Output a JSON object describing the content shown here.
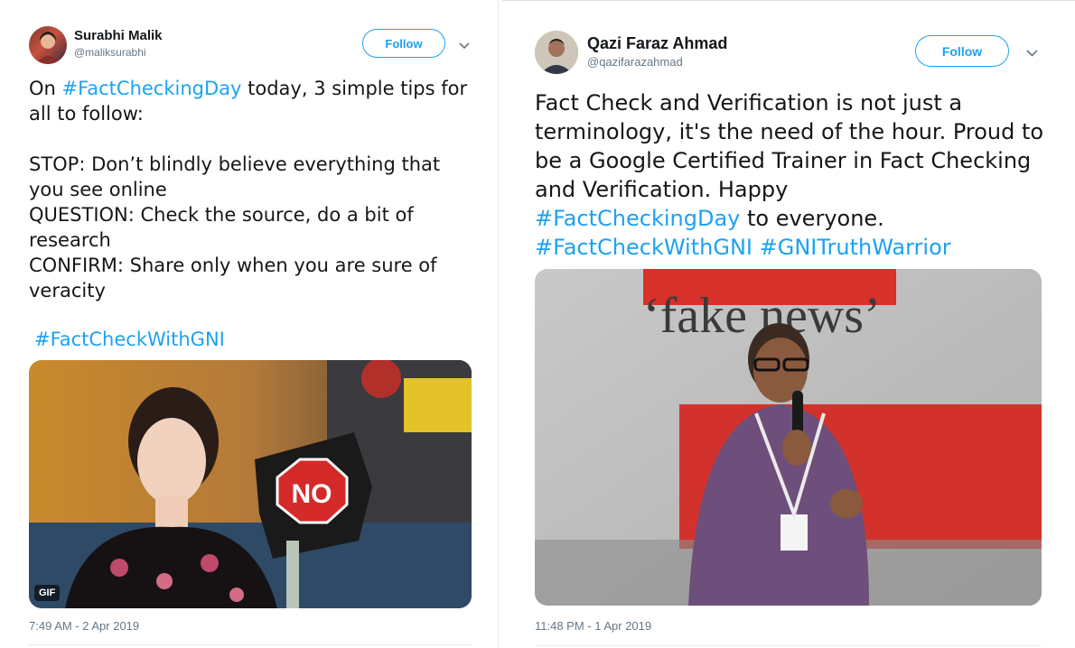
{
  "tweets": [
    {
      "name": "Surabhi Malik",
      "handle": "@maliksurabhi",
      "follow_label": "Follow",
      "text_prefix": "On ",
      "hashtag_inline": "#FactCheckingDay",
      "text_rest": " today, 3 simple tips for all to follow:\n\nSTOP: Don’t blindly believe everything that you see online\nQUESTION: Check the source, do a bit of research\nCONFIRM: Share only when you are sure of veracity",
      "hashtag_footer": "#FactCheckWithGNI",
      "media": {
        "badge": "GIF",
        "sign_text": "NO"
      },
      "timestamp": "7:49 AM - 2 Apr 2019"
    },
    {
      "name": "Qazi Faraz Ahmad",
      "handle": "@qazifarazahmad",
      "follow_label": "Follow",
      "text_before": "Fact Check and Verification is not just a terminology, it's the need of the hour. Proud to be a Google Certified Trainer in Fact Checking and Verification. Happy\n",
      "hashtag_inline": "#FactCheckingDay",
      "text_after": " to everyone.\n",
      "hashtag_1": "#FactCheckWithGNI",
      "hashtag_2": "#GNITruthWarrior",
      "media": {
        "banner_text": "‘fake news’"
      },
      "timestamp": "11:48 PM - 1 Apr 2019"
    }
  ],
  "colors": {
    "link": "#1da1f2",
    "text": "#14171a",
    "muted": "#657786"
  },
  "icons": {
    "menu": "chevron-down-icon"
  }
}
